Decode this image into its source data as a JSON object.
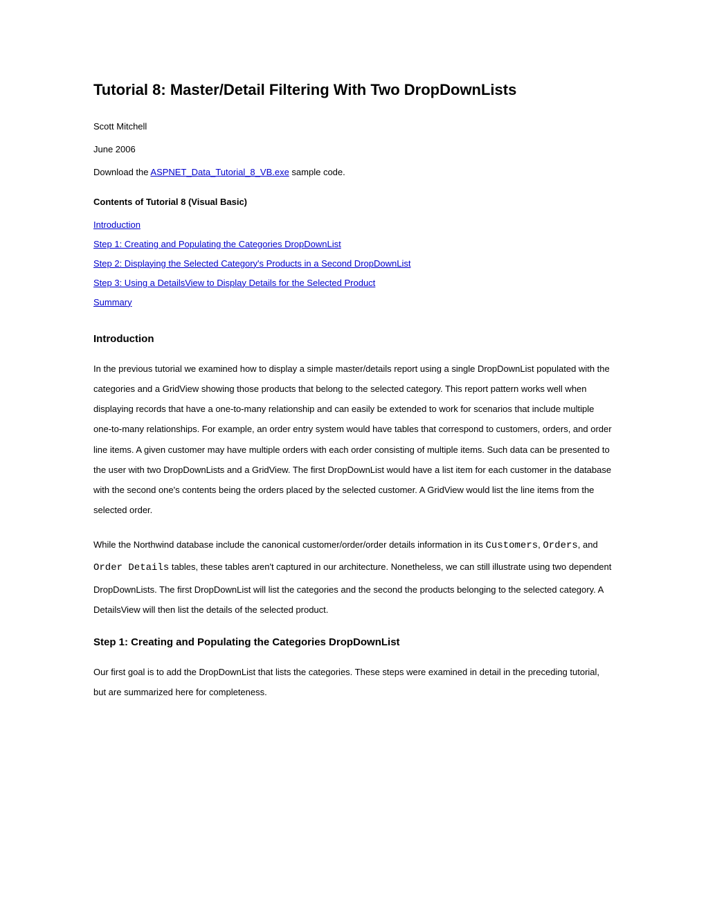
{
  "title": "Tutorial 8: Master/Detail Filtering With Two DropDownLists",
  "author": "Scott Mitchell",
  "date": "June 2006",
  "download_prefix": "Download the ",
  "download_link": "ASPNET_Data_Tutorial_8_VB.exe",
  "download_suffix": " sample code.",
  "contents_label": "Contents of Tutorial 8 (Visual Basic)",
  "toc": {
    "intro": "Introduction",
    "step1": "Step 1: Creating and Populating the Categories DropDownList",
    "step2": "Step 2: Displaying the Selected Category's Products in a Second DropDownList",
    "step3": "Step 3: Using a DetailsView to Display Details for the Selected Product",
    "summary": "Summary"
  },
  "intro_heading": "Introduction",
  "intro_para": "In the previous tutorial we examined how to display a simple master/details report using a single DropDownList populated with the categories and a GridView showing those products that belong to the selected category. This report pattern works well when displaying records that have a one-to-many relationship and can easily be extended to work for scenarios that include multiple one-to-many relationships. For example, an order entry system would have tables that correspond to customers, orders, and order line items. A given customer may have multiple orders with each order consisting of multiple items. Such data can be presented to the user with two DropDownLists and a GridView. The first DropDownList would have a list item for each customer in the database with the second one's contents being the orders placed by the selected customer. A GridView would list the line items from the selected order.",
  "para2_pre": "While the Northwind database include the canonical customer/order/order details information in its ",
  "code_customers": "Customers",
  "para2_sep1": ", ",
  "code_orders": "Orders",
  "para2_sep2": ", and ",
  "code_orderdetails": "Order Details",
  "para2_post": " tables, these tables aren't captured in our architecture. Nonetheless, we can still illustrate using two dependent DropDownLists. The first DropDownList will list the categories and the second the products belonging to the selected category. A DetailsView will then list the details of the selected product.",
  "step1_heading": "Step 1: Creating and Populating the Categories DropDownList",
  "step1_para": "Our first goal is to add the DropDownList that lists the categories. These steps were examined in detail in the preceding tutorial, but are summarized here for completeness."
}
